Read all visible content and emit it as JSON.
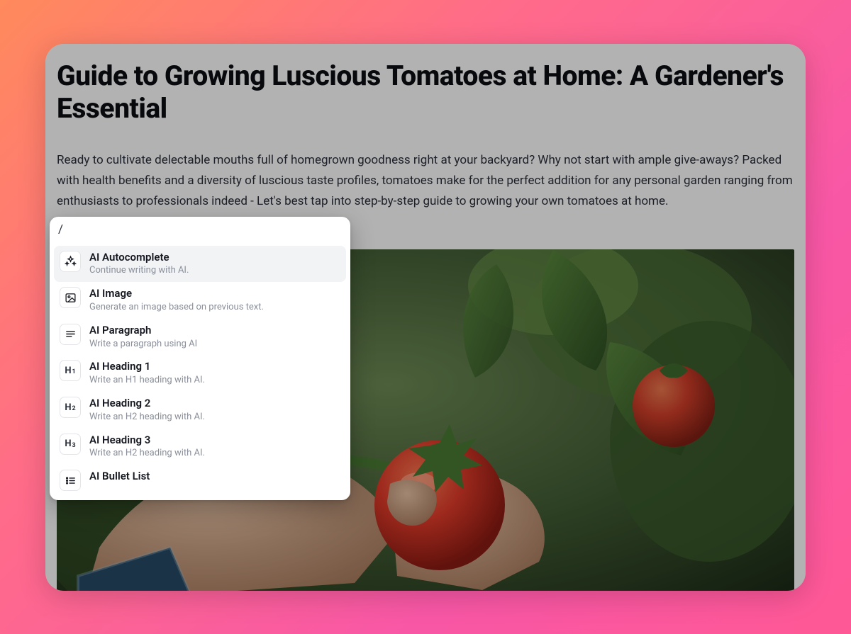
{
  "article": {
    "title": "Guide to Growing Luscious Tomatoes at Home: A Gardener's Essential",
    "intro": "Ready to cultivate delectable mouths full of homegrown goodness right at your backyard? Why not start with ample give-aways? Packed with health benefits and a diversity of luscious taste profiles, tomatoes make for the perfect addition for any personal garden ranging from enthusiasts to professionals indeed - Let's best tap into step-by-step guide to growing your own tomatoes at home."
  },
  "slash_menu": {
    "input": "/",
    "items": [
      {
        "icon": "sparkles",
        "title": "AI Autocomplete",
        "desc": "Continue writing with AI.",
        "selected": true
      },
      {
        "icon": "image",
        "title": "AI Image",
        "desc": "Generate an image based on previous text.",
        "selected": false
      },
      {
        "icon": "paragraph",
        "title": "AI Paragraph",
        "desc": "Write a paragraph using AI",
        "selected": false
      },
      {
        "icon": "H1",
        "title": "AI Heading 1",
        "desc": "Write an H1 heading with AI.",
        "selected": false
      },
      {
        "icon": "H2",
        "title": "AI Heading 2",
        "desc": "Write an H2 heading with AI.",
        "selected": false
      },
      {
        "icon": "H3",
        "title": "AI Heading 3",
        "desc": "Write an H2 heading with AI.",
        "selected": false
      },
      {
        "icon": "bullets",
        "title": "AI Bullet List",
        "desc": "",
        "selected": false
      }
    ]
  }
}
